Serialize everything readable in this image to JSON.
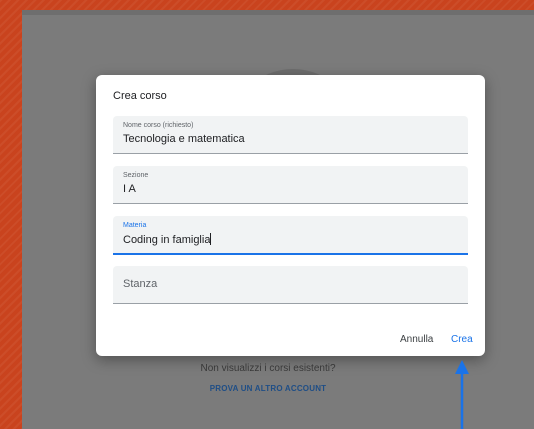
{
  "background": {
    "accent_color": "#c9431e",
    "overlay_color": "#7b7b7b"
  },
  "page": {
    "no_courses_text": "Non visualizzi i corsi esistenti?",
    "other_account_link": "PROVA UN ALTRO ACCOUNT"
  },
  "dialog": {
    "title": "Crea corso",
    "fields": {
      "nome": {
        "label": "Nome corso (richiesto)",
        "value": "Tecnologia e matematica"
      },
      "sezione": {
        "label": "Sezione",
        "value": "I A"
      },
      "materia": {
        "label": "Materia",
        "value": "Coding in famiglia",
        "focused": true
      },
      "stanza": {
        "placeholder": "Stanza"
      }
    },
    "buttons": {
      "cancel_label": "Annulla",
      "create_label": "Crea"
    },
    "colors": {
      "primary": "#1a73e8",
      "field_background": "#f1f3f4"
    }
  },
  "annotation": {
    "arrow_icon": "arrow-up-icon",
    "arrow_color": "#1a73e8"
  }
}
